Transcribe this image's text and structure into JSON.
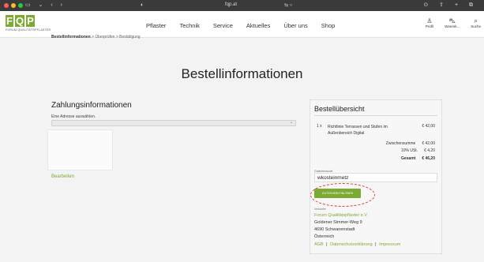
{
  "browser": {
    "url": "fqp.at",
    "left_controls": "▭ ⌄ ‹ ›",
    "tab_icon": "◐",
    "center_icon": "⇆ ○",
    "right_icons": "⊙ ⇪ + ⧉"
  },
  "header": {
    "logo_letters": [
      "F",
      "Q",
      "P"
    ],
    "logo_sub": "FORUM QUALITÄTSPFLASTER",
    "nav": [
      "Pflaster",
      "Technik",
      "Service",
      "Aktuelles",
      "Über uns",
      "Shop"
    ],
    "icons": [
      {
        "name": "profile-icon",
        "glyph": "♙",
        "label": "Profil"
      },
      {
        "name": "cart-icon",
        "glyph": "⛍",
        "label": "Warenk..."
      },
      {
        "name": "search-icon",
        "glyph": "⌕",
        "label": "Suche"
      }
    ]
  },
  "breadcrumb": {
    "current": "Bestellinformationen",
    "sep": ">",
    "step2": "Überprüfen",
    "step3": "Bestätigung"
  },
  "page_title": "Bestellinformationen",
  "payment": {
    "title": "Zahlungsinformationen",
    "address_label": "Eine Adresse auswählen.",
    "select_value": "",
    "edit_link": "Bearbeiten"
  },
  "summary": {
    "title": "Bestellübersicht",
    "item_qty": "1 x",
    "item_name": "Richtlinie Terrassen und Stufen im Außenbereich Digital",
    "item_price": "€ 42,00",
    "subtotal_label": "Zwischensumme",
    "subtotal_value": "€ 42,00",
    "tax_label": "10% USt.",
    "tax_value": "€ 4,20",
    "total_label": "Gesamt",
    "total_value": "€ 46,20",
    "voucher_label": "Gutscheincode",
    "voucher_value": "wkosteinmetz",
    "voucher_button": "GUTSCHEIN EINLÖSEN",
    "seller_label": "Verkäufer",
    "seller_name": "Forum Qualitätspflaster e.V.",
    "seller_street": "Goldener Simmer-Weg 9",
    "seller_city": "4690 Schwanenstadt",
    "seller_country": "Österreich",
    "link_agb": "AGB",
    "link_privacy": "Datenschutzerklärung",
    "link_imprint": "Impressum",
    "link_sep": "|"
  },
  "colors": {
    "brand_green": "#7cab34",
    "highlight_red": "#d9413a"
  }
}
